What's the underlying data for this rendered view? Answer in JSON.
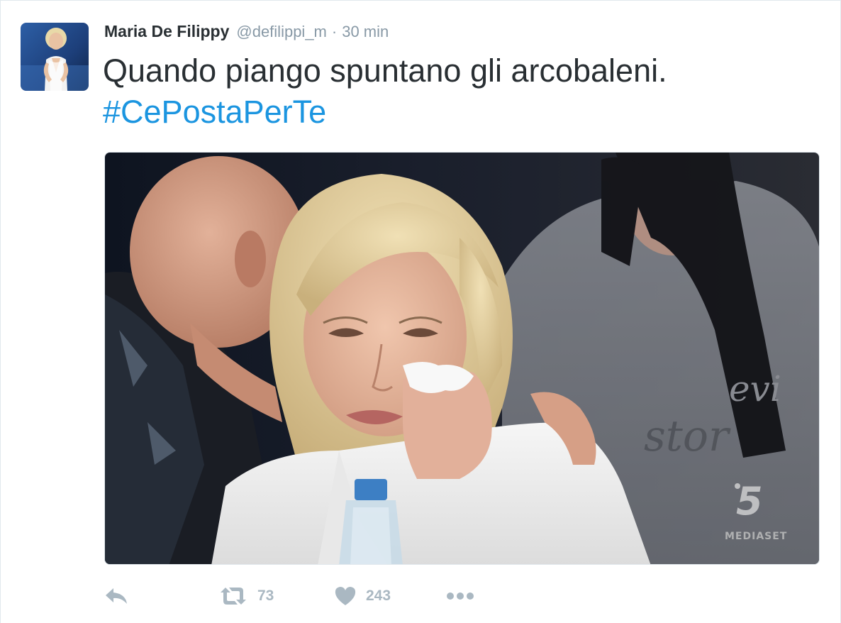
{
  "tweet": {
    "fullname": "Maria De Filippy",
    "username": "@defilippi_m",
    "separator": "·",
    "time": "30 min",
    "text": "Quando piango spuntano gli arcobaleni.",
    "hashtag": "#CePostaPerTe",
    "retweet_count": "73",
    "like_count": "243"
  },
  "media": {
    "watermark_number": "5",
    "watermark_label": "MEDIASET"
  },
  "icons": {
    "reply": "reply-icon",
    "retweet": "retweet-icon",
    "like": "heart-icon",
    "more": "more-icon"
  },
  "colors": {
    "hashtag": "#1b95e0",
    "muted": "#8899a6",
    "action": "#aab8c2",
    "text": "#292f33"
  }
}
